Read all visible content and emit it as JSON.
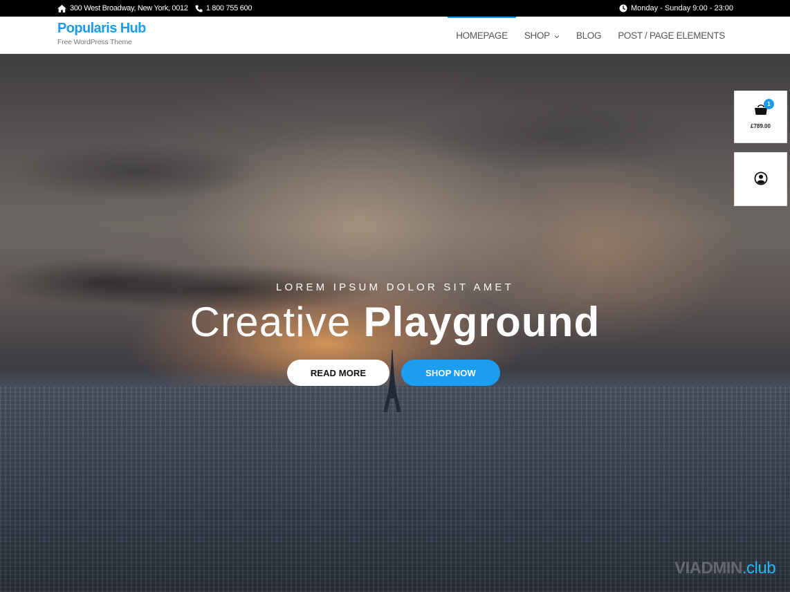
{
  "topbar": {
    "address": "300 West Broadway, New York, 0012",
    "phone": "1 800 755 600",
    "hours": "Monday - Sunday 9:00 - 23:00",
    "icons": {
      "address": "home-icon",
      "phone": "phone-icon",
      "hours": "clock-icon"
    }
  },
  "header": {
    "site_title": "Popularis Hub",
    "tagline": "Free WordPress Theme"
  },
  "nav": {
    "items": [
      {
        "label": "HOMEPAGE",
        "active": true
      },
      {
        "label": "SHOP",
        "has_dropdown": true
      },
      {
        "label": "BLOG"
      },
      {
        "label": "POST / PAGE ELEMENTS"
      }
    ]
  },
  "hero": {
    "kicker": "LOREM IPSUM DOLOR SIT AMET",
    "headline_light": "Creative",
    "headline_bold": "Playground",
    "read_more": "READ MORE",
    "shop_now": "SHOP NOW"
  },
  "cart": {
    "count": "1",
    "total": "£789.00",
    "icon": "shopping-bag-icon"
  },
  "account": {
    "icon": "user-circle-icon"
  },
  "watermark": {
    "part1": "VIADMIN",
    "part2": ".club"
  },
  "colors": {
    "accent": "#1b9be9",
    "topbar_bg": "#000000",
    "shop_button": "#1c9ef0"
  }
}
